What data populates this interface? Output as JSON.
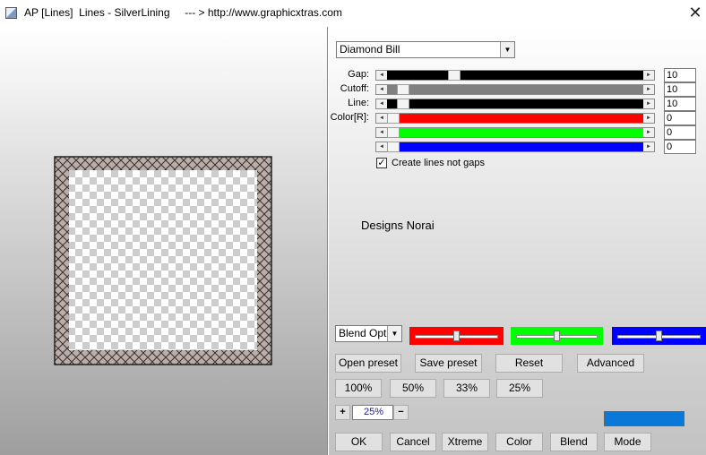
{
  "window": {
    "title": "AP [Lines]  Lines - SilverLining     --- > http://www.graphicxtras.com",
    "close_glyph": "✕"
  },
  "preset": {
    "selected": "Diamond Bill"
  },
  "sliders": [
    {
      "label": "Gap:",
      "value": "10",
      "fill": "#000000",
      "fraction": 0.25
    },
    {
      "label": "Cutoff:",
      "value": "10",
      "fill": "#808080",
      "fraction": 0.04
    },
    {
      "label": "Line:",
      "value": "10",
      "fill": "#000000",
      "fraction": 0.04
    },
    {
      "label": "Color[R]:",
      "value": "0",
      "fill": "#ff0000",
      "fraction": 0.0
    },
    {
      "label": "",
      "value": "0",
      "fill": "#00ff00",
      "fraction": 0.0
    },
    {
      "label": "",
      "value": "0",
      "fill": "#0000ff",
      "fraction": 0.0
    }
  ],
  "checkbox": {
    "label": "Create lines not gaps",
    "checked": true,
    "mark": "✓"
  },
  "watermark": "Designs Norai",
  "blend": {
    "selected": "Blend Optic",
    "colors": [
      {
        "color": "#ff0000",
        "level": 0.5
      },
      {
        "color": "#00ff00",
        "level": 0.5
      },
      {
        "color": "#0000ff",
        "level": 0.5
      }
    ]
  },
  "buttons": {
    "open_preset": "Open preset",
    "save_preset": "Save preset",
    "reset": "Reset",
    "advanced": "Advanced",
    "zoom_100": "100%",
    "zoom_50": "50%",
    "zoom_33": "33%",
    "zoom_25": "25%",
    "plus": "+",
    "minus": "−",
    "ok": "OK",
    "cancel": "Cancel",
    "xtreme": "Xtreme",
    "color": "Color",
    "blend": "Blend",
    "mode": "Mode"
  },
  "zoom": {
    "value": "25%"
  },
  "swatch_color": "#0a78d8"
}
